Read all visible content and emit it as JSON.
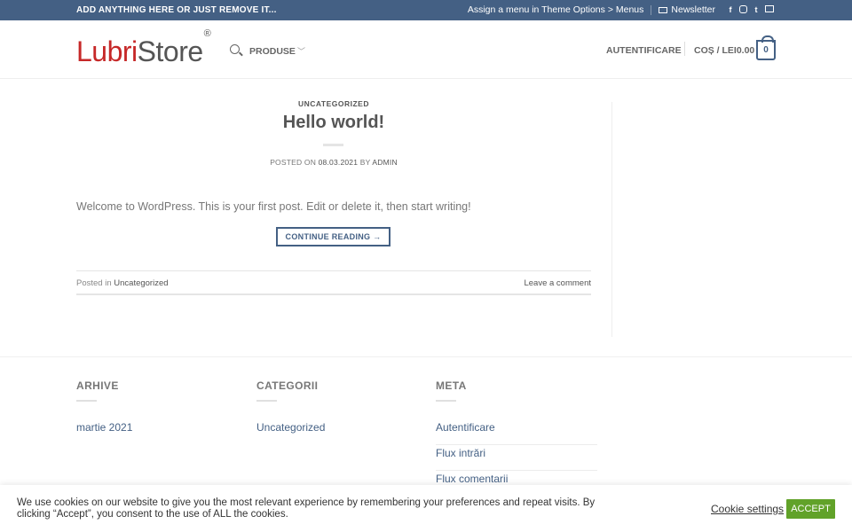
{
  "topbar": {
    "promo": "ADD ANYTHING HERE OR JUST REMOVE IT...",
    "menu_hint": "Assign a menu in Theme Options > Menus",
    "newsletter": "Newsletter",
    "social": [
      "facebook-icon",
      "instagram-icon",
      "twitter-icon",
      "mail-icon"
    ],
    "bg_color": "#446084"
  },
  "header": {
    "logo_part1": "Lubri",
    "logo_part2": "Store",
    "logo_mark": "®",
    "nav_produse": "PRODUSE",
    "login": "AUTENTIFICARE",
    "cart": "COȘ / LEI0.00",
    "cart_count": "0"
  },
  "post": {
    "category": "UNCATEGORIZED",
    "title": "Hello world!",
    "posted_on": "POSTED ON",
    "date": "08.03.2021",
    "by": "BY",
    "author": "ADMIN",
    "excerpt": "Welcome to WordPress. This is your first post. Edit or delete it, then start writing!",
    "continue": "CONTINUE READING →",
    "posted_in": "Posted in",
    "posted_in_cat": "Uncategorized",
    "leave_comment": "Leave a comment"
  },
  "footer": {
    "widgets": [
      {
        "title": "ARHIVE",
        "items": [
          "martie 2021"
        ]
      },
      {
        "title": "CATEGORII",
        "items": [
          "Uncategorized"
        ]
      },
      {
        "title": "META",
        "items": [
          "Autentificare",
          "Flux intrări",
          "Flux comentarii"
        ]
      }
    ]
  },
  "cookie": {
    "text": "We use cookies on our website to give you the most relevant experience by remembering your preferences and repeat visits. By clicking “Accept”, you consent to the use of ALL the cookies.",
    "settings": "Cookie settings",
    "accept": "ACCEPT",
    "accept_color": "#61a229"
  }
}
